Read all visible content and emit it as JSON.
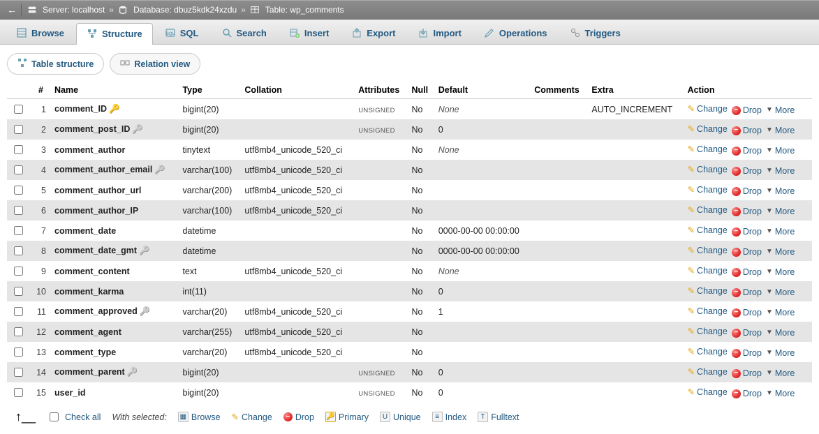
{
  "breadcrumb": {
    "server_label": "Server:",
    "server": "localhost",
    "database_label": "Database:",
    "database": "dbuz5kdk24xzdu",
    "table_label": "Table:",
    "table": "wp_comments"
  },
  "tabs": {
    "browse": "Browse",
    "structure": "Structure",
    "sql": "SQL",
    "search": "Search",
    "insert": "Insert",
    "export": "Export",
    "import": "Import",
    "operations": "Operations",
    "triggers": "Triggers"
  },
  "subtabs": {
    "table_structure": "Table structure",
    "relation_view": "Relation view"
  },
  "headers": {
    "num": "#",
    "name": "Name",
    "type": "Type",
    "collation": "Collation",
    "attributes": "Attributes",
    "null": "Null",
    "default": "Default",
    "comments": "Comments",
    "extra": "Extra",
    "action": "Action"
  },
  "action_labels": {
    "change": "Change",
    "drop": "Drop",
    "more": "More"
  },
  "bottom": {
    "check_all": "Check all",
    "with_selected": "With selected:",
    "browse": "Browse",
    "change": "Change",
    "drop": "Drop",
    "primary": "Primary",
    "unique": "Unique",
    "index": "Index",
    "fulltext": "Fulltext"
  },
  "columns": [
    {
      "num": "1",
      "name": "comment_ID",
      "key": "primary",
      "type": "bigint(20)",
      "collation": "",
      "attributes": "UNSIGNED",
      "null": "No",
      "default": "None",
      "default_italic": true,
      "comments": "",
      "extra": "AUTO_INCREMENT"
    },
    {
      "num": "2",
      "name": "comment_post_ID",
      "key": "index",
      "type": "bigint(20)",
      "collation": "",
      "attributes": "UNSIGNED",
      "null": "No",
      "default": "0",
      "comments": "",
      "extra": ""
    },
    {
      "num": "3",
      "name": "comment_author",
      "key": "",
      "type": "tinytext",
      "collation": "utf8mb4_unicode_520_ci",
      "attributes": "",
      "null": "No",
      "default": "None",
      "default_italic": true,
      "comments": "",
      "extra": ""
    },
    {
      "num": "4",
      "name": "comment_author_email",
      "key": "index",
      "type": "varchar(100)",
      "collation": "utf8mb4_unicode_520_ci",
      "attributes": "",
      "null": "No",
      "default": "",
      "comments": "",
      "extra": ""
    },
    {
      "num": "5",
      "name": "comment_author_url",
      "key": "",
      "type": "varchar(200)",
      "collation": "utf8mb4_unicode_520_ci",
      "attributes": "",
      "null": "No",
      "default": "",
      "comments": "",
      "extra": ""
    },
    {
      "num": "6",
      "name": "comment_author_IP",
      "key": "",
      "type": "varchar(100)",
      "collation": "utf8mb4_unicode_520_ci",
      "attributes": "",
      "null": "No",
      "default": "",
      "comments": "",
      "extra": ""
    },
    {
      "num": "7",
      "name": "comment_date",
      "key": "",
      "type": "datetime",
      "collation": "",
      "attributes": "",
      "null": "No",
      "default": "0000-00-00 00:00:00",
      "comments": "",
      "extra": ""
    },
    {
      "num": "8",
      "name": "comment_date_gmt",
      "key": "index",
      "type": "datetime",
      "collation": "",
      "attributes": "",
      "null": "No",
      "default": "0000-00-00 00:00:00",
      "comments": "",
      "extra": ""
    },
    {
      "num": "9",
      "name": "comment_content",
      "key": "",
      "type": "text",
      "collation": "utf8mb4_unicode_520_ci",
      "attributes": "",
      "null": "No",
      "default": "None",
      "default_italic": true,
      "comments": "",
      "extra": ""
    },
    {
      "num": "10",
      "name": "comment_karma",
      "key": "",
      "type": "int(11)",
      "collation": "",
      "attributes": "",
      "null": "No",
      "default": "0",
      "comments": "",
      "extra": ""
    },
    {
      "num": "11",
      "name": "comment_approved",
      "key": "index",
      "type": "varchar(20)",
      "collation": "utf8mb4_unicode_520_ci",
      "attributes": "",
      "null": "No",
      "default": "1",
      "comments": "",
      "extra": ""
    },
    {
      "num": "12",
      "name": "comment_agent",
      "key": "",
      "type": "varchar(255)",
      "collation": "utf8mb4_unicode_520_ci",
      "attributes": "",
      "null": "No",
      "default": "",
      "comments": "",
      "extra": ""
    },
    {
      "num": "13",
      "name": "comment_type",
      "key": "",
      "type": "varchar(20)",
      "collation": "utf8mb4_unicode_520_ci",
      "attributes": "",
      "null": "No",
      "default": "",
      "comments": "",
      "extra": ""
    },
    {
      "num": "14",
      "name": "comment_parent",
      "key": "index",
      "type": "bigint(20)",
      "collation": "",
      "attributes": "UNSIGNED",
      "null": "No",
      "default": "0",
      "comments": "",
      "extra": ""
    },
    {
      "num": "15",
      "name": "user_id",
      "key": "",
      "type": "bigint(20)",
      "collation": "",
      "attributes": "UNSIGNED",
      "null": "No",
      "default": "0",
      "comments": "",
      "extra": ""
    }
  ]
}
